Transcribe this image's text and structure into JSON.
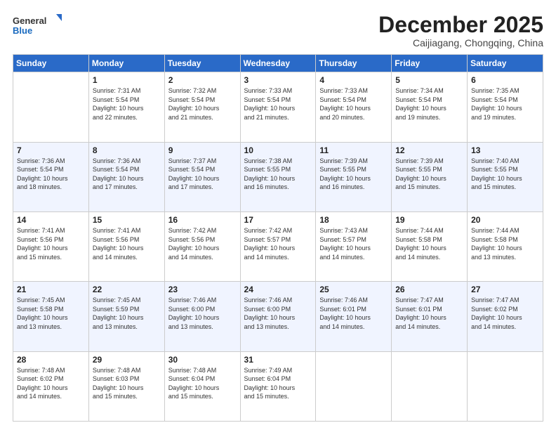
{
  "logo": {
    "line1": "General",
    "line2": "Blue"
  },
  "header": {
    "month": "December 2025",
    "location": "Caijiagang, Chongqing, China"
  },
  "weekdays": [
    "Sunday",
    "Monday",
    "Tuesday",
    "Wednesday",
    "Thursday",
    "Friday",
    "Saturday"
  ],
  "weeks": [
    [
      {
        "day": "",
        "info": ""
      },
      {
        "day": "1",
        "info": "Sunrise: 7:31 AM\nSunset: 5:54 PM\nDaylight: 10 hours\nand 22 minutes."
      },
      {
        "day": "2",
        "info": "Sunrise: 7:32 AM\nSunset: 5:54 PM\nDaylight: 10 hours\nand 21 minutes."
      },
      {
        "day": "3",
        "info": "Sunrise: 7:33 AM\nSunset: 5:54 PM\nDaylight: 10 hours\nand 21 minutes."
      },
      {
        "day": "4",
        "info": "Sunrise: 7:33 AM\nSunset: 5:54 PM\nDaylight: 10 hours\nand 20 minutes."
      },
      {
        "day": "5",
        "info": "Sunrise: 7:34 AM\nSunset: 5:54 PM\nDaylight: 10 hours\nand 19 minutes."
      },
      {
        "day": "6",
        "info": "Sunrise: 7:35 AM\nSunset: 5:54 PM\nDaylight: 10 hours\nand 19 minutes."
      }
    ],
    [
      {
        "day": "7",
        "info": "Sunrise: 7:36 AM\nSunset: 5:54 PM\nDaylight: 10 hours\nand 18 minutes."
      },
      {
        "day": "8",
        "info": "Sunrise: 7:36 AM\nSunset: 5:54 PM\nDaylight: 10 hours\nand 17 minutes."
      },
      {
        "day": "9",
        "info": "Sunrise: 7:37 AM\nSunset: 5:54 PM\nDaylight: 10 hours\nand 17 minutes."
      },
      {
        "day": "10",
        "info": "Sunrise: 7:38 AM\nSunset: 5:55 PM\nDaylight: 10 hours\nand 16 minutes."
      },
      {
        "day": "11",
        "info": "Sunrise: 7:39 AM\nSunset: 5:55 PM\nDaylight: 10 hours\nand 16 minutes."
      },
      {
        "day": "12",
        "info": "Sunrise: 7:39 AM\nSunset: 5:55 PM\nDaylight: 10 hours\nand 15 minutes."
      },
      {
        "day": "13",
        "info": "Sunrise: 7:40 AM\nSunset: 5:55 PM\nDaylight: 10 hours\nand 15 minutes."
      }
    ],
    [
      {
        "day": "14",
        "info": "Sunrise: 7:41 AM\nSunset: 5:56 PM\nDaylight: 10 hours\nand 15 minutes."
      },
      {
        "day": "15",
        "info": "Sunrise: 7:41 AM\nSunset: 5:56 PM\nDaylight: 10 hours\nand 14 minutes."
      },
      {
        "day": "16",
        "info": "Sunrise: 7:42 AM\nSunset: 5:56 PM\nDaylight: 10 hours\nand 14 minutes."
      },
      {
        "day": "17",
        "info": "Sunrise: 7:42 AM\nSunset: 5:57 PM\nDaylight: 10 hours\nand 14 minutes."
      },
      {
        "day": "18",
        "info": "Sunrise: 7:43 AM\nSunset: 5:57 PM\nDaylight: 10 hours\nand 14 minutes."
      },
      {
        "day": "19",
        "info": "Sunrise: 7:44 AM\nSunset: 5:58 PM\nDaylight: 10 hours\nand 14 minutes."
      },
      {
        "day": "20",
        "info": "Sunrise: 7:44 AM\nSunset: 5:58 PM\nDaylight: 10 hours\nand 13 minutes."
      }
    ],
    [
      {
        "day": "21",
        "info": "Sunrise: 7:45 AM\nSunset: 5:58 PM\nDaylight: 10 hours\nand 13 minutes."
      },
      {
        "day": "22",
        "info": "Sunrise: 7:45 AM\nSunset: 5:59 PM\nDaylight: 10 hours\nand 13 minutes."
      },
      {
        "day": "23",
        "info": "Sunrise: 7:46 AM\nSunset: 6:00 PM\nDaylight: 10 hours\nand 13 minutes."
      },
      {
        "day": "24",
        "info": "Sunrise: 7:46 AM\nSunset: 6:00 PM\nDaylight: 10 hours\nand 13 minutes."
      },
      {
        "day": "25",
        "info": "Sunrise: 7:46 AM\nSunset: 6:01 PM\nDaylight: 10 hours\nand 14 minutes."
      },
      {
        "day": "26",
        "info": "Sunrise: 7:47 AM\nSunset: 6:01 PM\nDaylight: 10 hours\nand 14 minutes."
      },
      {
        "day": "27",
        "info": "Sunrise: 7:47 AM\nSunset: 6:02 PM\nDaylight: 10 hours\nand 14 minutes."
      }
    ],
    [
      {
        "day": "28",
        "info": "Sunrise: 7:48 AM\nSunset: 6:02 PM\nDaylight: 10 hours\nand 14 minutes."
      },
      {
        "day": "29",
        "info": "Sunrise: 7:48 AM\nSunset: 6:03 PM\nDaylight: 10 hours\nand 15 minutes."
      },
      {
        "day": "30",
        "info": "Sunrise: 7:48 AM\nSunset: 6:04 PM\nDaylight: 10 hours\nand 15 minutes."
      },
      {
        "day": "31",
        "info": "Sunrise: 7:49 AM\nSunset: 6:04 PM\nDaylight: 10 hours\nand 15 minutes."
      },
      {
        "day": "",
        "info": ""
      },
      {
        "day": "",
        "info": ""
      },
      {
        "day": "",
        "info": ""
      }
    ]
  ]
}
